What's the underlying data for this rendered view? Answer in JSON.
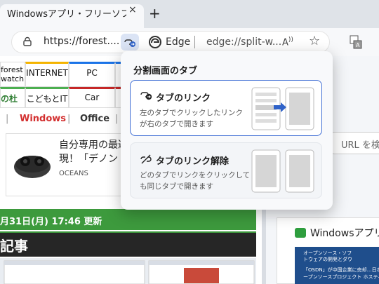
{
  "tab": {
    "title": "Windowsアプリ・フリーソフトのおすすめ",
    "close": "×",
    "new_tab": "+"
  },
  "toolbar": {
    "url_left": "https://forest....",
    "edge_label": "Edge",
    "url_right": "edge://split-w...",
    "read_aloud": "A",
    "favorite": "☆"
  },
  "page": {
    "nav": [
      {
        "label": "forest\nwatch"
      },
      {
        "label": "INTERNET"
      },
      {
        "label": "PC"
      },
      {
        "label": ""
      },
      {
        "label": "の杜"
      },
      {
        "label": "こどもとIT"
      },
      {
        "label": "Car"
      },
      {
        "label": ""
      }
    ],
    "categories": {
      "windows": "Windows",
      "office": "Office",
      "sep": "|"
    },
    "ad": {
      "line1": "自分専用の最適",
      "line2": "現！「デノン",
      "source": "OCEANS"
    },
    "date": "月31日(月) 17:46 更新",
    "heading": "記事"
  },
  "right_pane": {
    "url_placeholder": "URL を検",
    "card_title": "Windowsアプリ・",
    "card_img_lines": [
      "オープンソース・ソフ",
      "トウェアの開発とダウ",
      "「OSDN」が中国企業に売却…日本の",
      "ープンソースプロジェクト ホスティ"
    ]
  },
  "popup": {
    "title": "分割画面のタブ",
    "options": [
      {
        "head": "タブのリンク",
        "desc1": "左のタブでクリックしたリンク",
        "desc2": "が右のタブで開きます"
      },
      {
        "head": "タブのリンク解除",
        "desc1": "どのタブでリンクをクリックして",
        "desc2": "も同じタブで開きます"
      }
    ]
  },
  "colors": {
    "accent": "#3f6ed4",
    "green": "#3d9a3d",
    "windows_red": "#d32f2f"
  }
}
